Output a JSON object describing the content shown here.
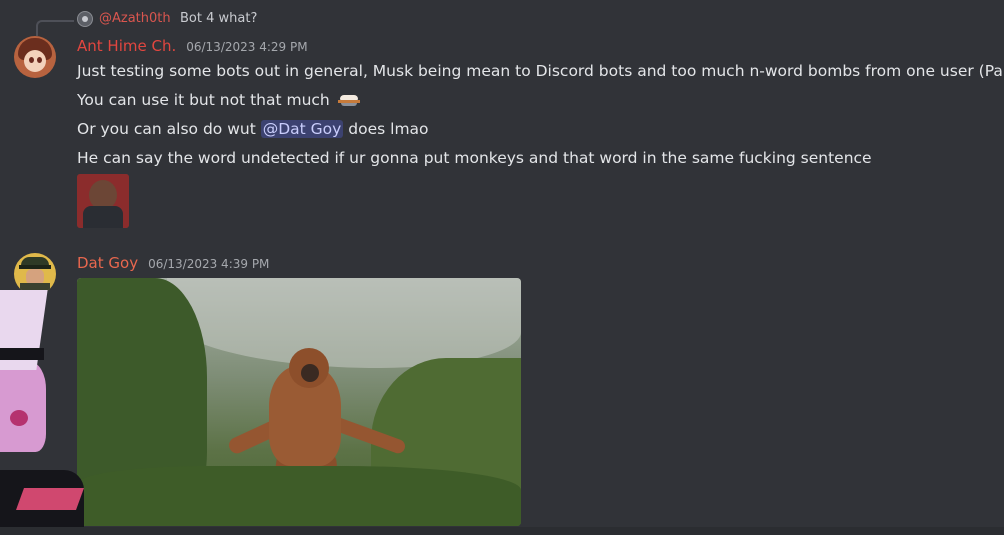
{
  "reply": {
    "username": "@Azath0th",
    "text": "Bot 4 what?"
  },
  "messages": [
    {
      "username": "Ant Hime Ch.",
      "timestamp": "06/13/2023 4:29 PM",
      "lines": [
        "Just testing some bots out in general, Musk being mean to Discord bots and too much n-word bombs from one user (Pan)",
        "You can use it but not that much",
        "Or you can also do wut ",
        "He can say the word undetected if ur gonna put monkeys and that word in the same fucking sentence"
      ],
      "mention": "@Dat Goy",
      "after_mention": " does lmao",
      "emoji": "rowboat-emoji",
      "sticker": "man-portrait-sticker"
    },
    {
      "username": "Dat Goy",
      "timestamp": "06/13/2023 4:39 PM",
      "attachment": "dancing-orangutan-gif"
    }
  ],
  "colors": {
    "background": "#313338",
    "ant_username": "#e2463f",
    "goy_username": "#e8674e",
    "reply_username": "#d9564f",
    "mention_bg": "#3c4270",
    "mention_fg": "#c9cdfb"
  }
}
